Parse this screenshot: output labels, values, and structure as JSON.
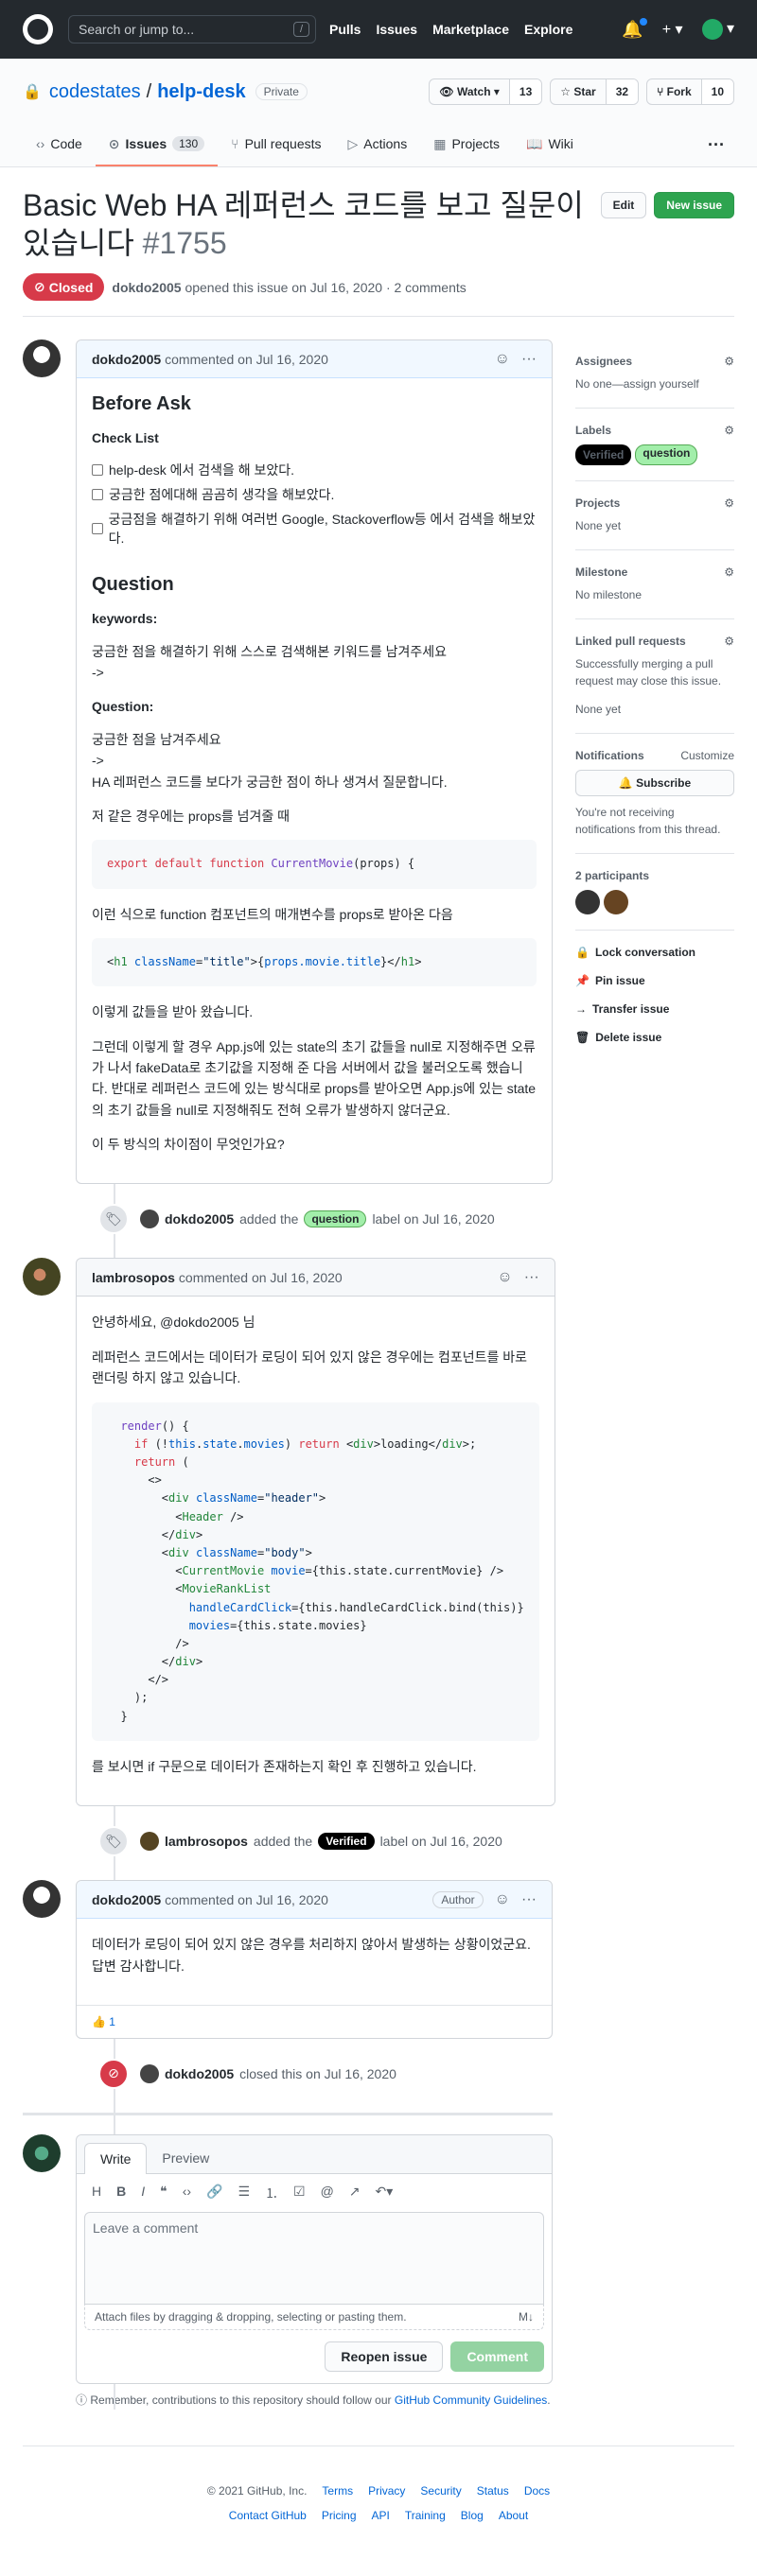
{
  "header": {
    "search_placeholder": "Search or jump to...",
    "slash": "/",
    "nav": [
      "Pulls",
      "Issues",
      "Marketplace",
      "Explore"
    ],
    "plus": "+ ▾",
    "avatar_caret": "▾"
  },
  "repo": {
    "owner": "codestates",
    "sep": "/",
    "name": "help-desk",
    "visibility": "Private",
    "watch": {
      "label": "Watch ▾",
      "count": "13"
    },
    "star": {
      "label": "Star",
      "count": "32"
    },
    "fork": {
      "label": "Fork",
      "count": "10"
    }
  },
  "tabs": [
    {
      "label": "Code",
      "icon": "‹›"
    },
    {
      "label": "Issues",
      "icon": "⊙",
      "count": "130"
    },
    {
      "label": "Pull requests",
      "icon": "⑂"
    },
    {
      "label": "Actions",
      "icon": "▷"
    },
    {
      "label": "Projects",
      "icon": "▦"
    },
    {
      "label": "Wiki",
      "icon": "📖"
    }
  ],
  "issue": {
    "title": "Basic Web HA 레퍼런스 코드를 보고 질문이 있습니다",
    "number": "#1755",
    "edit": "Edit",
    "new_issue": "New issue",
    "state": "Closed",
    "author": "dokdo2005",
    "meta": "opened this issue on Jul 16, 2020 · 2 comments"
  },
  "c1": {
    "author": "dokdo2005",
    "date": "commented on Jul 16, 2020",
    "h_before": "Before Ask",
    "checklist_title": "Check List",
    "checks": [
      "help-desk 에서 검색을 해 보았다.",
      "궁금한 점에대해 곰곰히 생각을 해보았다.",
      "궁금점을 해결하기 위해 여러번 Google, Stackoverflow등 에서 검색을 해보았다."
    ],
    "h_question": "Question",
    "keywords_title": "keywords:",
    "keywords_body": "궁금한 점을 해결하기 위해 스스로 검색해본 키워드를 남겨주세요",
    "arrow1": "->",
    "question_title": "Question:",
    "q1": "궁금한 점을 남겨주세요",
    "arrow2": "->",
    "q2": "HA 레퍼런스 코드를 보다가 궁금한 점이 하나 생겨서 질문합니다.",
    "p1": "저 같은 경우에는 props를 넘겨줄 때",
    "p2": "이런 식으로 function 컴포넌트의 매개변수를 props로 받아온 다음",
    "p3": "이렇게 값들을 받아 왔습니다.",
    "p4": "그런데 이렇게 할 경우 App.js에 있는 state의 초기 값들을 null로 지정해주면 오류가 나서 fakeData로 초기값을 지정해 준 다음 서버에서 값을 불러오도록 했습니다. 반대로 레퍼런스 코드에 있는 방식대로 props를 받아오면 App.js에 있는 state의 초기 값들을 null로 지정해줘도 전혀 오류가 발생하지 않더군요.",
    "p5": "이 두 방식의 차이점이 무엇인가요?"
  },
  "e1": {
    "author": "dokdo2005",
    "pre": "added the",
    "label": "question",
    "post": "label on Jul 16, 2020"
  },
  "c2": {
    "author": "lambrosopos",
    "date": "commented on Jul 16, 2020",
    "greet": "안녕하세요, @dokdo2005 님",
    "p1": "레퍼런스 코드에서는 데이터가 로딩이 되어 있지 않은 경우에는 컴포넌트를 바로 랜더링 하지 않고 있습니다.",
    "p2": "를 보시면 if 구문으로 데이터가 존재하는지 확인 후 진행하고 있습니다."
  },
  "e2": {
    "author": "lambrosopos",
    "pre": "added the",
    "label": "Verified",
    "post": "label on Jul 16, 2020"
  },
  "c3": {
    "author": "dokdo2005",
    "date": "commented on Jul 16, 2020",
    "badge": "Author",
    "p1": "데이터가 로딩이 되어 있지 않은 경우를 처리하지 않아서 발생하는 상황이었군요.",
    "p2": "답변 감사합니다.",
    "reaction": "👍 1"
  },
  "e3": {
    "author": "dokdo2005",
    "text": "closed this on Jul 16, 2020"
  },
  "form": {
    "tab_write": "Write",
    "tab_preview": "Preview",
    "placeholder": "Leave a comment",
    "attach": "Attach files by dragging & dropping, selecting or pasting them.",
    "reopen": "Reopen issue",
    "comment": "Comment",
    "note_pre": "Remember, contributions to this repository should follow our",
    "note_link": "GitHub Community Guidelines",
    "note_post": "."
  },
  "sidebar": {
    "assignees": "Assignees",
    "assignees_v": "No one—assign yourself",
    "labels": "Labels",
    "label1": "Verified",
    "label2": "question",
    "projects": "Projects",
    "projects_v": "None yet",
    "milestone": "Milestone",
    "milestone_v": "No milestone",
    "linked": "Linked pull requests",
    "linked_v": "Successfully merging a pull request may close this issue.",
    "linked_v2": "None yet",
    "notifications": "Notifications",
    "customize": "Customize",
    "subscribe": "🔔 Subscribe",
    "notif_v": "You're not receiving notifications from this thread.",
    "participants": "2 participants",
    "lock": "Lock conversation",
    "pin": "Pin issue",
    "transfer": "Transfer issue",
    "delete": "Delete issue"
  },
  "footer": {
    "row1": [
      "© 2021 GitHub, Inc.",
      "Terms",
      "Privacy",
      "Security",
      "Status",
      "Docs"
    ],
    "row2": [
      "Contact GitHub",
      "Pricing",
      "API",
      "Training",
      "Blog",
      "About"
    ]
  },
  "colors": {
    "closed": "#d73a49",
    "accent": "#0366d6",
    "green": "#2ea44f"
  }
}
